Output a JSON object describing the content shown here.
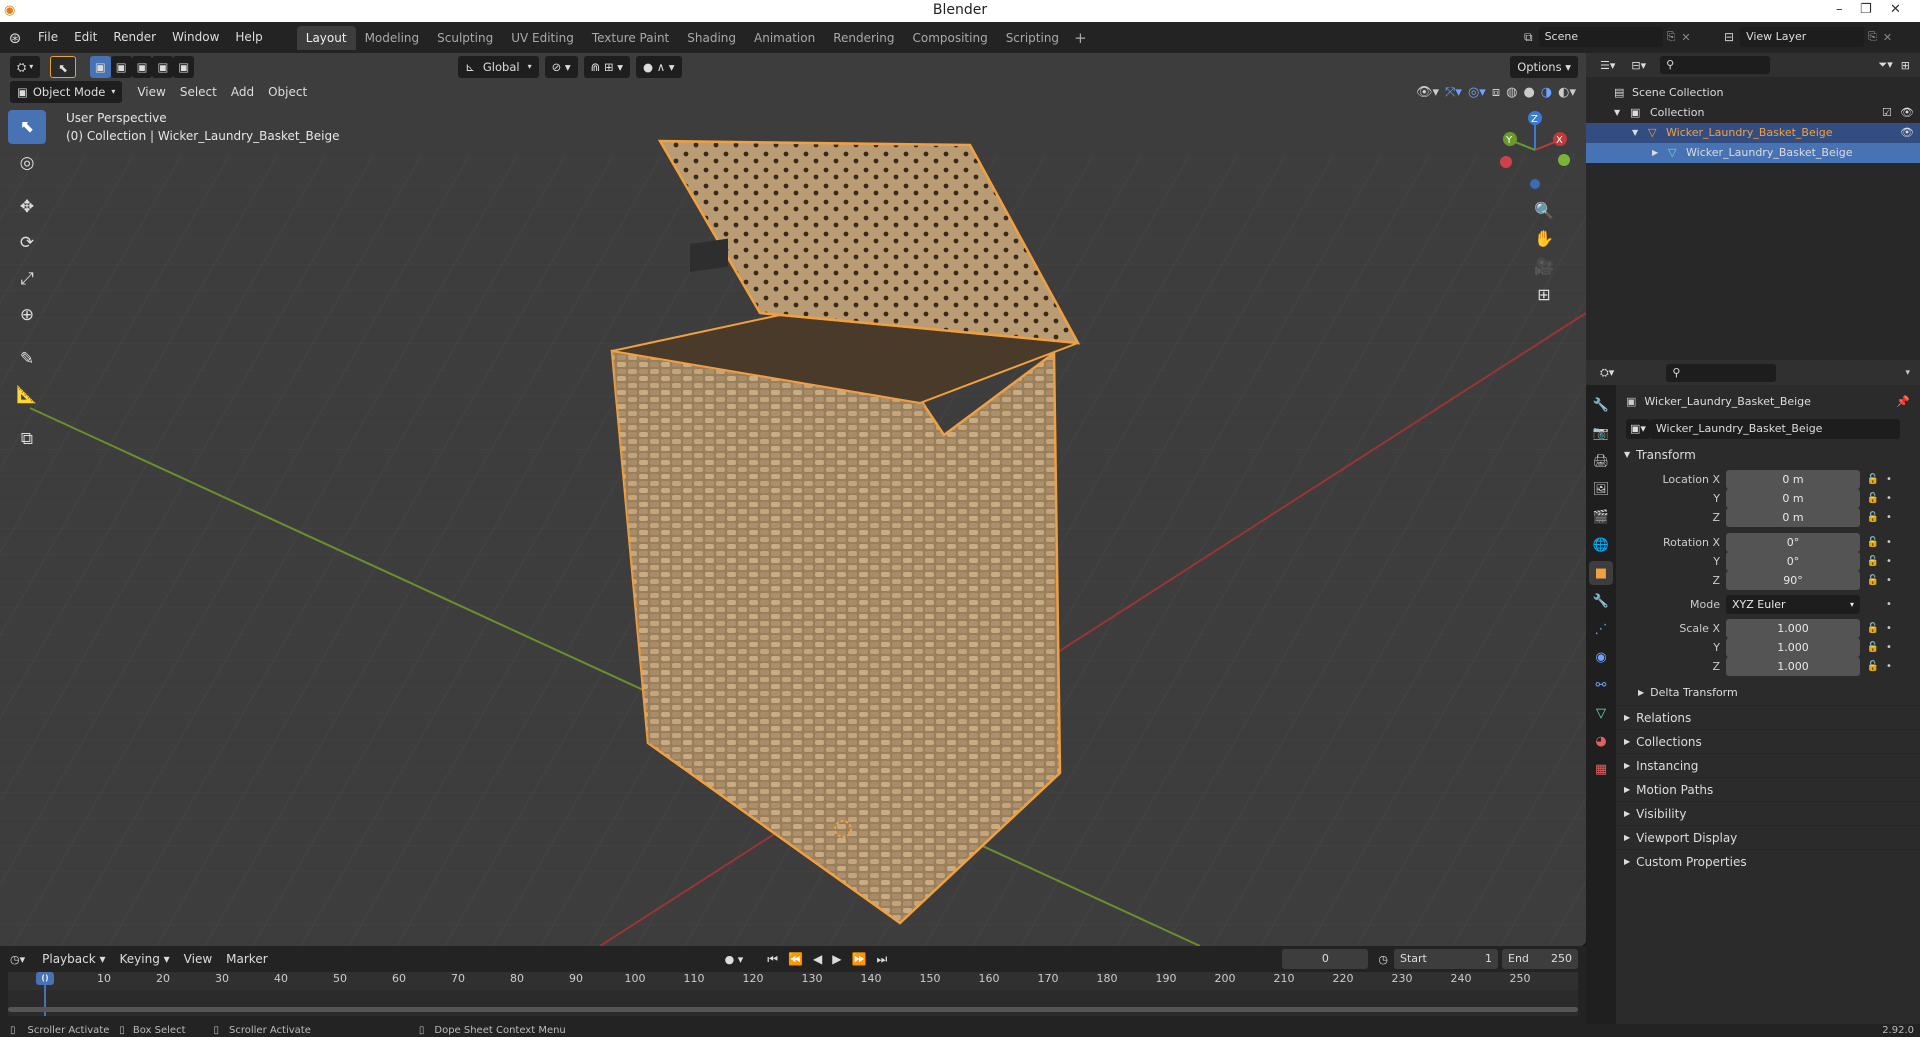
{
  "app": {
    "title": "Blender",
    "version": "2.92.0"
  },
  "menu": {
    "file": "File",
    "edit": "Edit",
    "render": "Render",
    "window": "Window",
    "help": "Help"
  },
  "workspaces": [
    "Layout",
    "Modeling",
    "Sculpting",
    "UV Editing",
    "Texture Paint",
    "Shading",
    "Animation",
    "Rendering",
    "Compositing",
    "Scripting"
  ],
  "active_workspace": "Layout",
  "scene": {
    "name": "Scene",
    "view_layer": "View Layer"
  },
  "viewport_header": {
    "orientation": "Global",
    "options": "Options",
    "mode": "Object Mode",
    "menus": [
      "View",
      "Select",
      "Add",
      "Object"
    ]
  },
  "viewport": {
    "perspective": "User Perspective",
    "collection_info": "(0) Collection | Wicker_Laundry_Basket_Beige",
    "axes": {
      "x": "X",
      "y": "Y",
      "z": "Z"
    }
  },
  "outliner": {
    "scene_collection": "Scene Collection",
    "collection": "Collection",
    "object": "Wicker_Laundry_Basket_Beige",
    "mesh": "Wicker_Laundry_Basket_Beige"
  },
  "properties": {
    "object_name": "Wicker_Laundry_Basket_Beige",
    "object_field": "Wicker_Laundry_Basket_Beige",
    "transform_label": "Transform",
    "location": {
      "label": "Location X",
      "x": "0 m",
      "y": "0 m",
      "z": "0 m"
    },
    "rotation": {
      "label": "Rotation X",
      "x": "0°",
      "y": "0°",
      "z": "90°"
    },
    "mode": {
      "label": "Mode",
      "value": "XYZ Euler"
    },
    "scale": {
      "label": "Scale X",
      "x": "1.000",
      "y": "1.000",
      "z": "1.000"
    },
    "axis_y": "Y",
    "axis_z": "Z",
    "delta_transform": "Delta Transform",
    "sections": [
      "Relations",
      "Collections",
      "Instancing",
      "Motion Paths",
      "Visibility",
      "Viewport Display",
      "Custom Properties"
    ]
  },
  "timeline": {
    "menus": [
      "Playback",
      "Keying",
      "View",
      "Marker"
    ],
    "current_frame": "0",
    "start_label": "Start",
    "start": "1",
    "end_label": "End",
    "end": "250",
    "ticks": [
      "0",
      "10",
      "20",
      "30",
      "40",
      "50",
      "60",
      "70",
      "80",
      "90",
      "100",
      "110",
      "120",
      "130",
      "140",
      "150",
      "160",
      "170",
      "180",
      "190",
      "200",
      "210",
      "220",
      "230",
      "240",
      "250"
    ]
  },
  "statusbar": {
    "left1": "Scroller Activate",
    "left2": "Box Select",
    "left3": "Scroller Activate",
    "left4": "Dope Sheet Context Menu"
  },
  "colors": {
    "accent": "#4772b3",
    "selection_outline": "#f0a040",
    "x_axis": "#c0393b",
    "y_axis": "#6a9a2a",
    "z_axis": "#3a7bd5"
  }
}
